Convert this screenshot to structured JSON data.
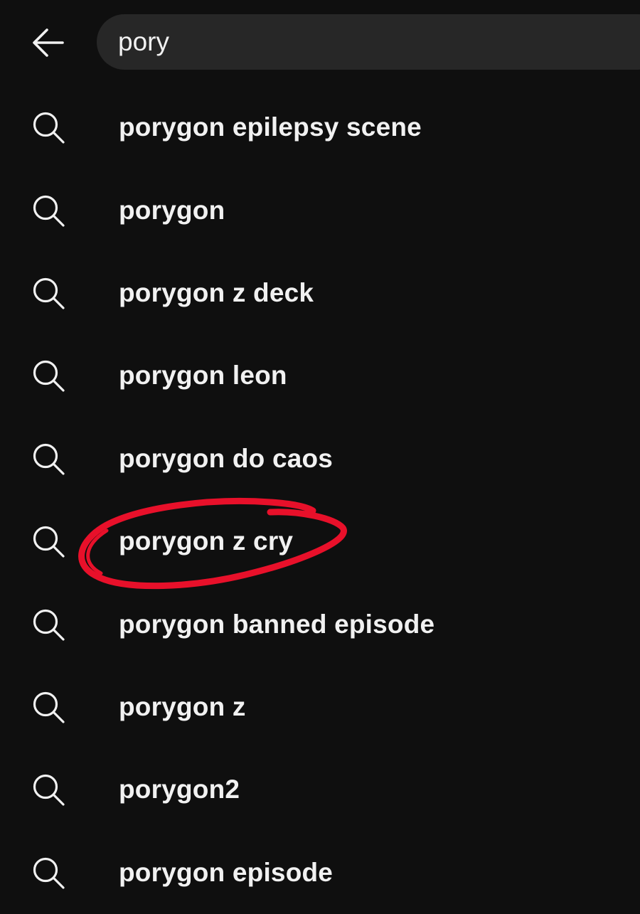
{
  "search": {
    "query": "pory"
  },
  "suggestions": [
    {
      "label": "porygon epilepsy scene"
    },
    {
      "label": "porygon"
    },
    {
      "label": "porygon z deck"
    },
    {
      "label": "porygon leon"
    },
    {
      "label": "porygon do caos"
    },
    {
      "label": "porygon z cry"
    },
    {
      "label": "porygon banned episode"
    },
    {
      "label": "porygon z"
    },
    {
      "label": "porygon2"
    },
    {
      "label": "porygon episode"
    }
  ],
  "icons": {
    "back": "back-arrow-icon",
    "suggestion": "search-icon"
  },
  "colors": {
    "background": "#0f0f0f",
    "search_box": "#272727",
    "text": "#f1f1f1",
    "annotation": "#e8102a"
  },
  "annotation": {
    "circled_item": "porygon z cry"
  }
}
